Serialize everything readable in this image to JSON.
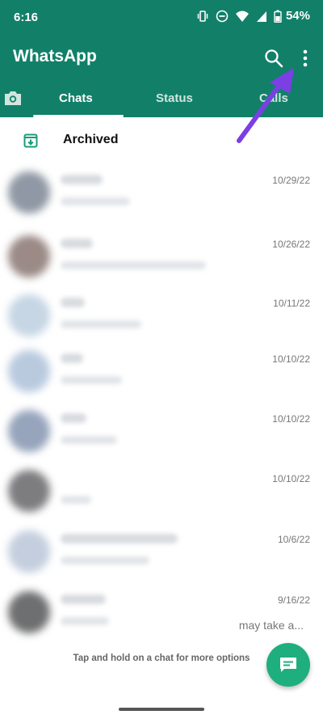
{
  "statusbar": {
    "time": "6:16",
    "battery": "54%"
  },
  "header": {
    "title": "WhatsApp"
  },
  "icons": {
    "search": "search-icon",
    "menu": "more-vert-icon",
    "camera": "camera-icon",
    "archive": "archive-icon",
    "new_chat": "chat-icon"
  },
  "tabs": [
    {
      "label": "Chats",
      "active": true
    },
    {
      "label": "Status",
      "active": false
    },
    {
      "label": "Calls",
      "active": false
    }
  ],
  "archived": {
    "label": "Archived"
  },
  "chats": [
    {
      "date": "10/29/22",
      "snippet": ""
    },
    {
      "date": "10/26/22",
      "snippet": ""
    },
    {
      "date": "10/11/22",
      "snippet": ""
    },
    {
      "date": "10/10/22",
      "snippet": ""
    },
    {
      "date": "10/10/22",
      "snippet": ""
    },
    {
      "date": "10/10/22",
      "snippet": ""
    },
    {
      "date": "10/6/22",
      "snippet": ""
    },
    {
      "date": "9/16/22",
      "snippet": "may take a..."
    }
  ],
  "hint": "Tap and hold on a chat for more options",
  "colors": {
    "header": "#128069",
    "accent": "#1fae7e",
    "annotation_arrow": "#7b3fe4"
  }
}
